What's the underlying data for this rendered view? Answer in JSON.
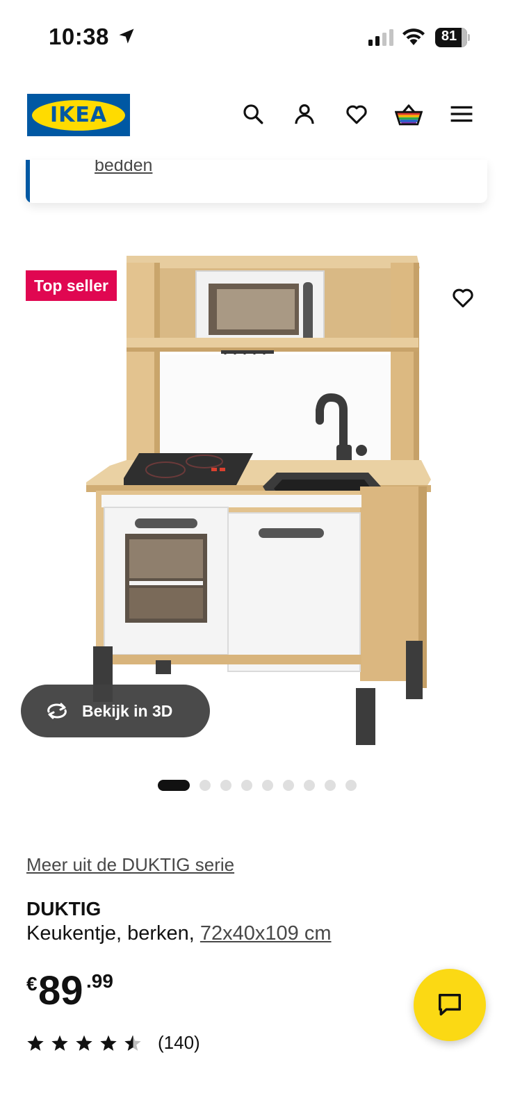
{
  "status_bar": {
    "time": "10:38",
    "battery": "81"
  },
  "header": {
    "logo_text": "IKEA",
    "icons": [
      "search-icon",
      "account-icon",
      "heart-icon",
      "basket-icon",
      "menu-icon"
    ]
  },
  "previous_card": {
    "link_text": "bedden"
  },
  "product_image": {
    "badge": "Top seller",
    "view_3d_label": "Bekijk in 3D",
    "slide_count": 9,
    "active_slide": 1
  },
  "product": {
    "series_link": "Meer uit de DUKTIG serie",
    "name": "DUKTIG",
    "description": "Keukentje, berken, ",
    "dimensions": "72x40x109 cm",
    "price_currency": "€",
    "price_integer": "89",
    "price_decimals": ".99",
    "rating_value": 4.5,
    "rating_count": "(140)"
  },
  "colors": {
    "ikea_blue": "#0058a3",
    "ikea_yellow": "#ffdb00",
    "badge_red": "#e00751",
    "chat_yellow": "#fbd914"
  }
}
